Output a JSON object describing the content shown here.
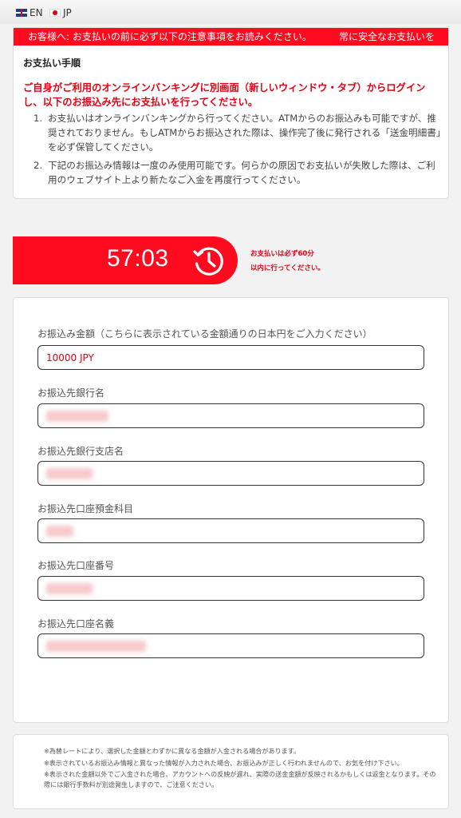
{
  "lang": {
    "en": "EN",
    "jp": "JP"
  },
  "notice": {
    "marquee_1": "お客様へ: お支払いの前に必ず以下の注意事項をお読みください。",
    "marquee_2": "常に安全なお支払いを",
    "steps_title": "お支払い手順",
    "warning": "ご自身がご利用のオンラインバンキングに別画面（新しいウィンドウ・タブ）からログインし、以下のお振込み先にお支払いを行ってください。",
    "steps": [
      {
        "num": "1.",
        "text": "お支払いはオンラインバンキングから行ってください。ATMからのお振込みも可能ですが、推奨されておりません。もしATMからお振込された際は、操作完了後に発行される「送金明細書」を必ず保管してください。"
      },
      {
        "num": "2.",
        "text": "下記のお振込み情報は一度のみ使用可能です。何らかの原因でお支払いが失敗した際は、ご利用のウェブサイト上より新たなご入金を再度行ってください。"
      }
    ]
  },
  "timer": {
    "value": "57:03",
    "note_line1": "お支払いは必ず60分",
    "note_line2": "以内に行ってください。"
  },
  "form": {
    "fields": [
      {
        "label": "お振込み金額（こちらに表示されている金額通りの日本円をご入力ください）",
        "value": "10000 JPY"
      },
      {
        "label": "お振込先銀行名",
        "value": ""
      },
      {
        "label": "お振込先銀行支店名",
        "value": ""
      },
      {
        "label": "お振込先口座預金科目",
        "value": ""
      },
      {
        "label": "お振込先口座番号",
        "value": ""
      },
      {
        "label": "お振込先口座名義",
        "value": ""
      }
    ]
  },
  "footer": {
    "notes": [
      "※為替レートにより、選択した金額とわずかに異なる金額が入金される場合があります。",
      "※表示されているお振込み情報と異なった情報が入力された場合、お振込みが正しく行われませんので、お気を付け下さい。",
      "※表示された金額以外でご入金された場合、アカウントへの反映が遅れ、実際の送金金額が反映されるかもしくは返金となります。その際には銀行手数料が別途発生しますので、ご注意ください。"
    ]
  },
  "colors": {
    "accent": "#ff0a1e",
    "warning_text": "#e60012"
  },
  "icons": {
    "timer": "clock-history-icon",
    "lang_en": "uk-flag-icon",
    "lang_jp": "japan-flag-icon"
  }
}
